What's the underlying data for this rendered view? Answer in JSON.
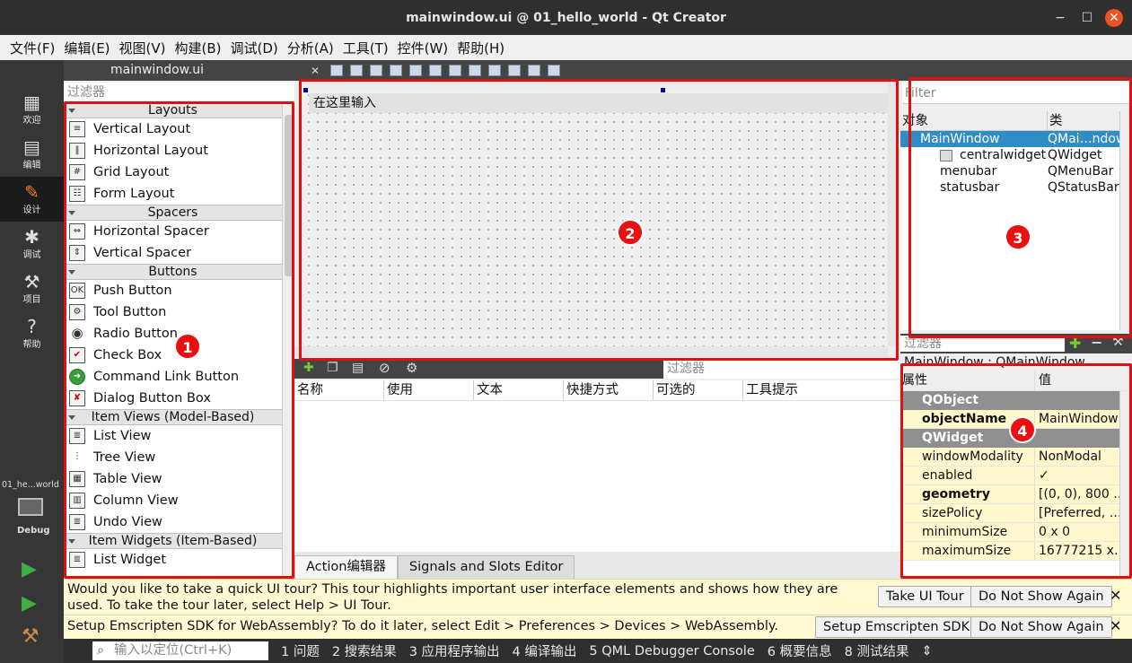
{
  "window": {
    "title": "mainwindow.ui @ 01_hello_world - Qt Creator",
    "min": "−",
    "max": "☐",
    "close": "✕"
  },
  "menu": [
    "文件(F)",
    "编辑(E)",
    "视图(V)",
    "构建(B)",
    "调试(D)",
    "分析(A)",
    "工具(T)",
    "控件(W)",
    "帮助(H)"
  ],
  "modes": [
    {
      "label": "欢迎",
      "icon": "grid-icon"
    },
    {
      "label": "编辑",
      "icon": "document-icon"
    },
    {
      "label": "设计",
      "icon": "pencil-icon"
    },
    {
      "label": "调试",
      "icon": "bug-icon"
    },
    {
      "label": "项目",
      "icon": "wrench-icon"
    },
    {
      "label": "帮助",
      "icon": "help-icon"
    }
  ],
  "project_target": {
    "name": "01_he...world",
    "config": "Debug"
  },
  "doc_tab": "mainwindow.ui",
  "widget_box": {
    "filter_placeholder": "过滤器",
    "categories": [
      {
        "name": "Layouts",
        "items": [
          "Vertical Layout",
          "Horizontal Layout",
          "Grid Layout",
          "Form Layout"
        ]
      },
      {
        "name": "Spacers",
        "items": [
          "Horizontal Spacer",
          "Vertical Spacer"
        ]
      },
      {
        "name": "Buttons",
        "items": [
          "Push Button",
          "Tool Button",
          "Radio Button",
          "Check Box",
          "Command Link Button",
          "Dialog Button Box"
        ]
      },
      {
        "name": "Item Views (Model-Based)",
        "items": [
          "List View",
          "Tree View",
          "Table View",
          "Column View",
          "Undo View"
        ]
      },
      {
        "name": "Item Widgets (Item-Based)",
        "items": [
          "List Widget"
        ]
      }
    ]
  },
  "form": {
    "menu_placeholder": "在这里输入"
  },
  "action_editor": {
    "filter_placeholder": "过滤器",
    "columns": [
      "名称",
      "使用",
      "文本",
      "快捷方式",
      "可选的",
      "工具提示"
    ],
    "tabs": [
      "Action编辑器",
      "Signals and Slots Editor"
    ]
  },
  "object_inspector": {
    "filter_placeholder": "Filter",
    "columns": [
      "对象",
      "类"
    ],
    "rows": [
      {
        "object": "MainWindow",
        "class": "QMai…ndow",
        "selected": true
      },
      {
        "object": "centralwidget",
        "class": "QWidget"
      },
      {
        "object": "menubar",
        "class": "QMenuBar"
      },
      {
        "object": "statusbar",
        "class": "QStatusBar"
      }
    ]
  },
  "property_editor": {
    "filter_placeholder": "过滤器",
    "class_label": "MainWindow : QMainWindow",
    "columns": [
      "属性",
      "值"
    ],
    "rows": [
      {
        "type": "cat",
        "name": "QObject"
      },
      {
        "type": "prop",
        "name": "objectName",
        "value": "MainWindow",
        "bold": true,
        "yellow": true
      },
      {
        "type": "cat",
        "name": "QWidget"
      },
      {
        "type": "prop",
        "name": "windowModality",
        "value": "NonModal",
        "yellow": true
      },
      {
        "type": "prop",
        "name": "enabled",
        "value": "✓",
        "yellow": true
      },
      {
        "type": "prop",
        "name": "geometry",
        "value": "[(0, 0), 800 …",
        "bold": true,
        "yellow": true,
        "expand": true
      },
      {
        "type": "prop",
        "name": "sizePolicy",
        "value": "[Preferred, …",
        "yellow": true,
        "expand": true
      },
      {
        "type": "prop",
        "name": "minimumSize",
        "value": "0 x 0",
        "yellow": true,
        "expand": true
      },
      {
        "type": "prop",
        "name": "maximumSize",
        "value": "16777215 x…",
        "yellow": true,
        "expand": true
      }
    ]
  },
  "badges": [
    "1",
    "2",
    "3",
    "4"
  ],
  "info_bars": [
    {
      "text": "Would you like to take a quick UI tour? This tour highlights important user interface elements and shows how they are used. To take the tour later, select Help > UI Tour.",
      "buttons": [
        "Take UI Tour",
        "Do Not Show Again"
      ]
    },
    {
      "text": "Setup Emscripten SDK for WebAssembly? To do it later, select Edit > Preferences > Devices > WebAssembly.",
      "buttons": [
        "Setup Emscripten SDK",
        "Do Not Show Again"
      ]
    }
  ],
  "status_bar": {
    "locate_placeholder": "输入以定位(Ctrl+K)",
    "items": [
      "1  问题",
      "2  搜索结果",
      "3  应用程序输出",
      "4  编译输出",
      "5  QML Debugger Console",
      "6  概要信息",
      "8  测试结果"
    ]
  },
  "colors": {
    "accent_red": "#e01010",
    "selection": "#308cc6",
    "close": "#e95420"
  }
}
